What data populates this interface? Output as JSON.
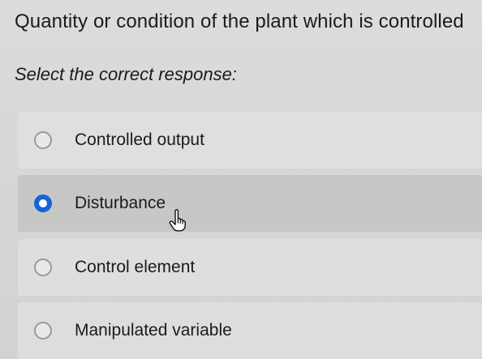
{
  "question": {
    "text": "Quantity or condition of the plant which is controlled"
  },
  "instruction": {
    "text": "Select the correct response:"
  },
  "options": [
    {
      "label": "Controlled output",
      "selected": false
    },
    {
      "label": "Disturbance",
      "selected": true
    },
    {
      "label": "Control element",
      "selected": false
    },
    {
      "label": "Manipulated variable",
      "selected": false
    }
  ],
  "icons": {
    "radio_unselected": "radio-unselected-icon",
    "radio_selected": "radio-selected-icon",
    "cursor": "hand-pointer-icon"
  },
  "colors": {
    "selected_radio": "#1565d8",
    "selected_background": "#c7c7c5"
  }
}
